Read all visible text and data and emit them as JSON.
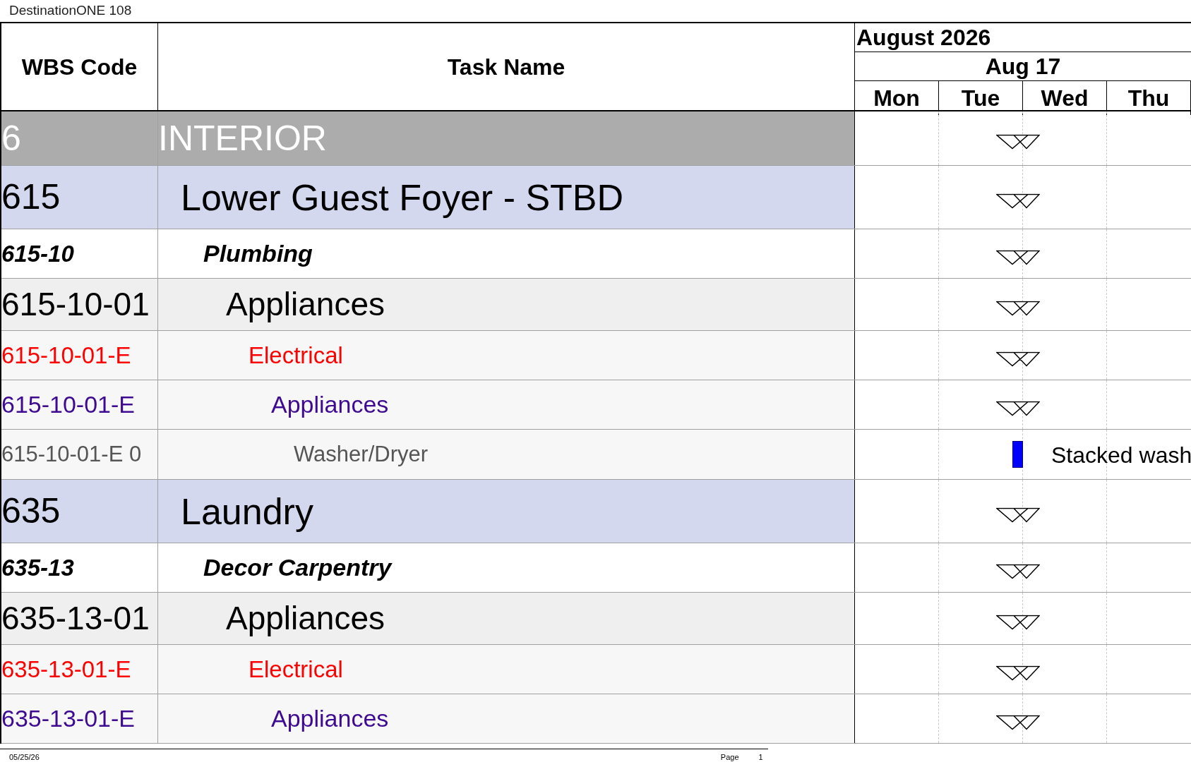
{
  "report_title": "DestinationONE 108",
  "columns": {
    "wbs": "WBS Code",
    "task": "Task Name"
  },
  "timescale": {
    "month": "August 2026",
    "week": "Aug 17",
    "days": [
      "Mon",
      "Tue",
      "Wed",
      "Thu"
    ]
  },
  "rows": [
    {
      "kind": "section",
      "wbs": "6",
      "name": "INTERIOR",
      "gantt": {
        "kind": "milestone"
      },
      "children": [
        {
          "kind": "area",
          "wbs": "615",
          "name": "Lower Guest Foyer - STBD",
          "gantt": {
            "kind": "milestone"
          },
          "children": [
            {
              "kind": "group",
              "wbs": "615-10",
              "name": "Plumbing",
              "gantt": {
                "kind": "milestone"
              },
              "children": [
                {
                  "kind": "item",
                  "wbs": "615-10-01",
                  "name": "Appliances",
                  "gantt": {
                    "kind": "milestone"
                  },
                  "children": [
                    {
                      "kind": "trade",
                      "wbs": "615-10-01-E",
                      "name": "Electrical",
                      "gantt": {
                        "kind": "milestone"
                      },
                      "children": [
                        {
                          "kind": "subtrade",
                          "wbs": "615-10-01-E",
                          "name": "Appliances",
                          "gantt": {
                            "kind": "milestone"
                          },
                          "children": [
                            {
                              "kind": "task",
                              "wbs": "615-10-01-E 0",
                              "name": "Washer/Dryer",
                              "gantt": {
                                "kind": "bar",
                                "label": "Stacked wash"
                              }
                            }
                          ]
                        }
                      ]
                    }
                  ]
                }
              ]
            }
          ]
        },
        {
          "kind": "area",
          "wbs": "635",
          "name": "Laundry",
          "gantt": {
            "kind": "milestone"
          },
          "children": [
            {
              "kind": "group",
              "wbs": "635-13",
              "name": "Decor Carpentry",
              "gantt": {
                "kind": "milestone"
              },
              "children": [
                {
                  "kind": "item",
                  "wbs": "635-13-01",
                  "name": "Appliances",
                  "gantt": {
                    "kind": "milestone"
                  },
                  "children": [
                    {
                      "kind": "trade",
                      "wbs": "635-13-01-E",
                      "name": "Electrical",
                      "gantt": {
                        "kind": "milestone"
                      },
                      "children": [
                        {
                          "kind": "subtrade",
                          "wbs": "635-13-01-E",
                          "name": "Appliances",
                          "gantt": {
                            "kind": "milestone"
                          }
                        }
                      ]
                    }
                  ]
                }
              ]
            }
          ]
        }
      ]
    }
  ],
  "footer": {
    "date": "05/25/26",
    "page_label": "Page",
    "page_number": "1"
  }
}
